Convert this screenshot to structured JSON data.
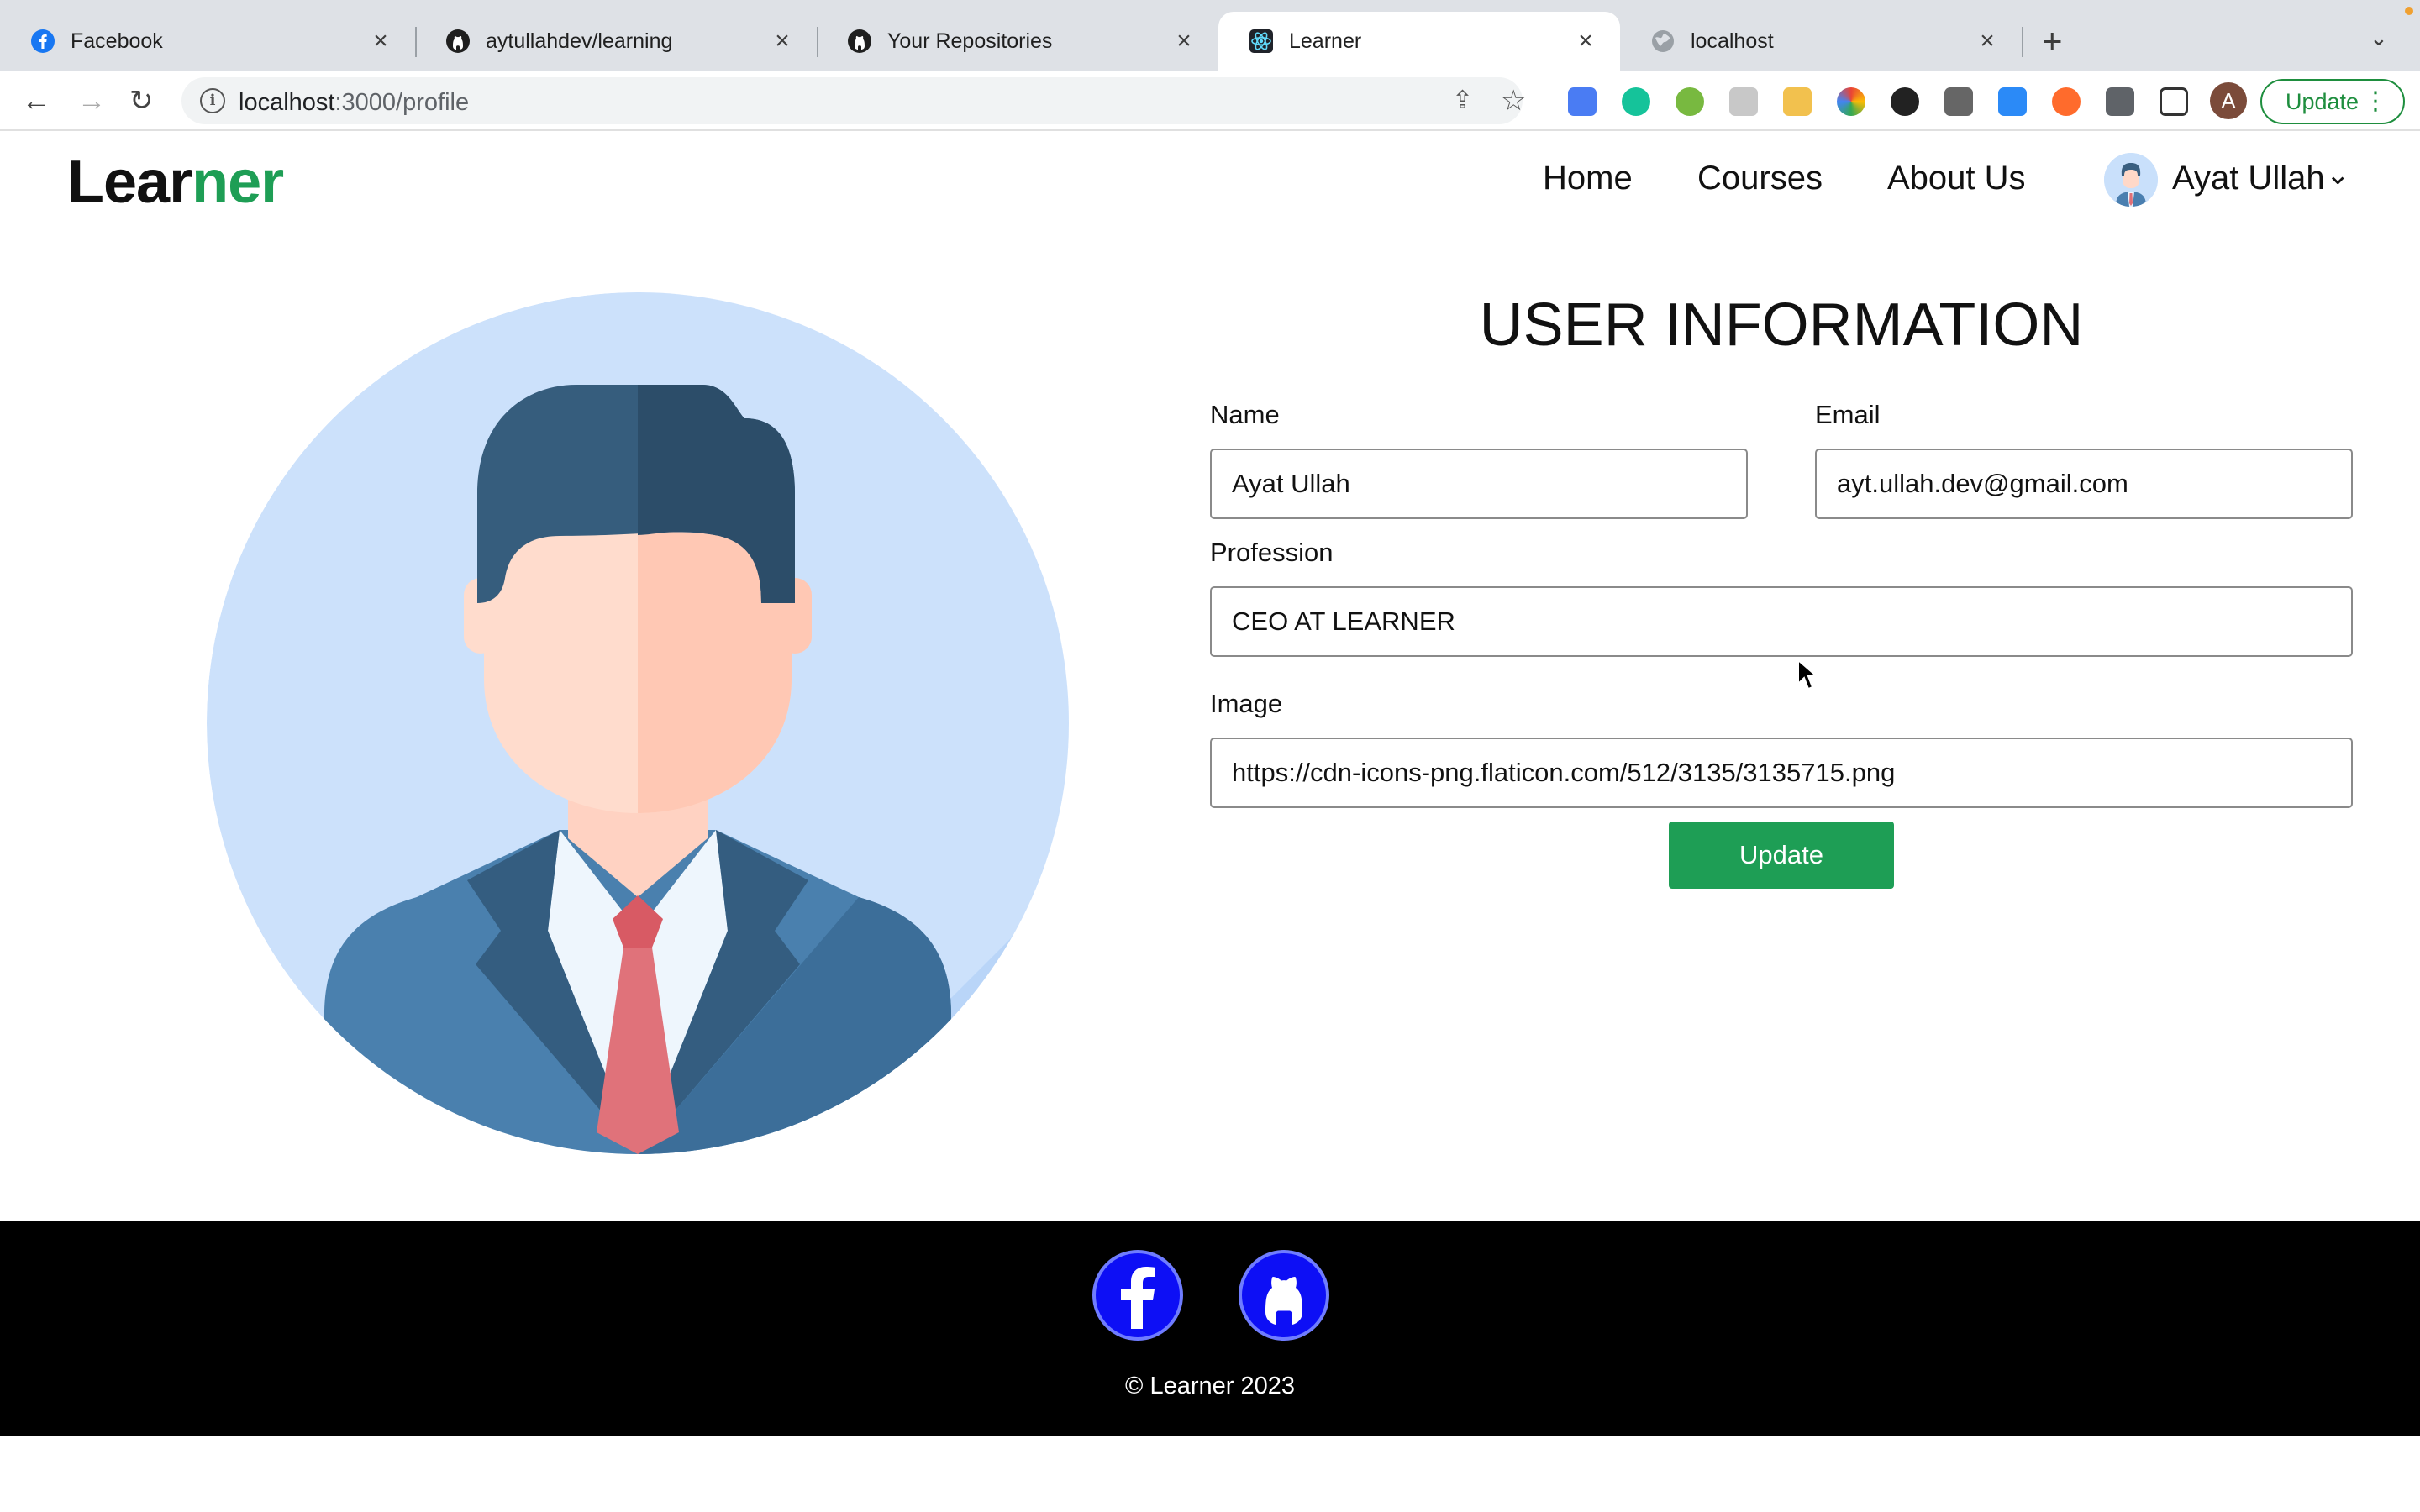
{
  "browser": {
    "tabs": [
      {
        "title": "Facebook",
        "icon": "facebook-icon",
        "active": false
      },
      {
        "title": "aytullahdev/learning",
        "icon": "github-icon",
        "active": false
      },
      {
        "title": "Your Repositories",
        "icon": "github-icon",
        "active": false
      },
      {
        "title": "Learner",
        "icon": "react-icon",
        "active": true
      },
      {
        "title": "localhost",
        "icon": "globe-icon",
        "active": false
      }
    ],
    "url_host": "localhost",
    "url_path": ":3000/profile",
    "profile_initial": "A",
    "update_label": "Update"
  },
  "site": {
    "logo_part1": "Lear",
    "logo_part2": "ner",
    "brand_color": "#1e9e55",
    "nav": [
      "Home",
      "Courses",
      "About Us"
    ],
    "user_name": "Ayat Ullah"
  },
  "form": {
    "title": "USER INFORMATION",
    "name_label": "Name",
    "name_value": "Ayat Ullah",
    "email_label": "Email",
    "email_value": "ayt.ullah.dev@gmail.com",
    "profession_label": "Profession",
    "profession_value": "CEO AT LEARNER",
    "image_label": "Image",
    "image_value": "https://cdn-icons-png.flaticon.com/512/3135/3135715.png",
    "submit_label": "Update"
  },
  "footer": {
    "social": [
      "facebook-icon",
      "github-icon"
    ],
    "copyright": "© Learner 2023"
  }
}
